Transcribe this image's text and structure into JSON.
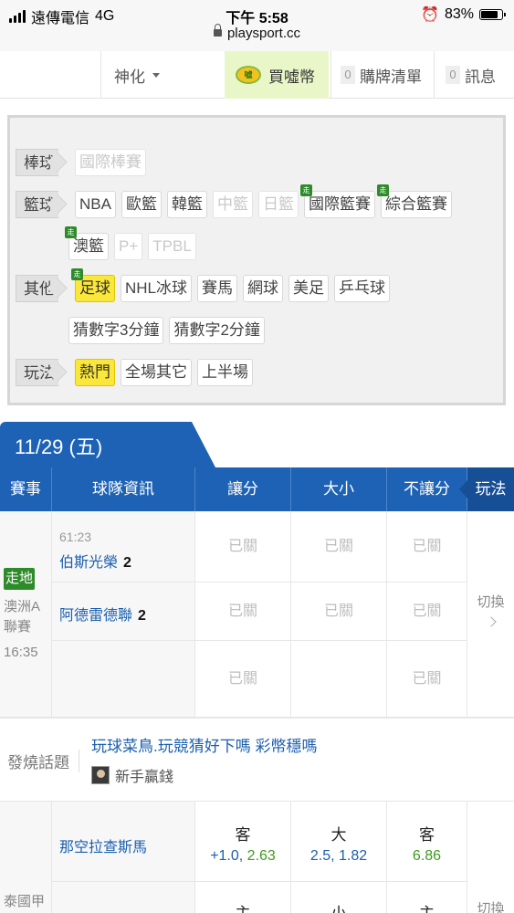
{
  "status_bar": {
    "carrier": "遠傳電信",
    "network": "4G",
    "time": "下午 5:58",
    "url": "playsport.cc",
    "battery": "83%",
    "battery_level": 0.83
  },
  "topnav": {
    "user": "神化",
    "coin_label": "買噓幣",
    "coin_icon_text": "噓",
    "cart_count": "0",
    "cart_label": "購牌清單",
    "msg_count": "0",
    "msg_label": "訊息"
  },
  "categories": {
    "baseball": {
      "label": "棒球",
      "items": [
        "國際棒賽"
      ]
    },
    "basketball": {
      "label": "籃球",
      "items": [
        "NBA",
        "歐籃",
        "韓籃",
        "中籃",
        "日籃",
        "國際籃賽",
        "綜合籃賽"
      ],
      "items2": [
        "澳籃",
        "P+",
        "TPBL"
      ]
    },
    "others": {
      "label": "其他",
      "items": [
        "足球",
        "NHL冰球",
        "賽馬",
        "網球",
        "美足",
        "乒乓球"
      ],
      "items2": [
        "猜數字3分鐘",
        "猜數字2分鐘"
      ]
    },
    "play": {
      "label": "玩法",
      "items": [
        "熱門",
        "全場其它",
        "上半場"
      ]
    },
    "live_badge": "走"
  },
  "date_tab": "11/29 (五)",
  "table_header": [
    "賽事",
    "球隊資訊",
    "讓分",
    "大小",
    "不讓分",
    "玩法"
  ],
  "match1": {
    "live_badge": "走地",
    "league": "澳洲A聯賽",
    "time": "16:35",
    "clock": "61:23",
    "team_away": "伯斯光榮",
    "score_away": "2",
    "team_home": "阿德雷德聯",
    "score_home": "2",
    "closed": "已關",
    "switch": "切換"
  },
  "hot_topic": {
    "label": "發燒話題",
    "title": "玩球菜鳥.玩競猜好下嗎 彩幣穩嗎",
    "author": "新手贏錢"
  },
  "match2": {
    "league": "泰國甲",
    "team_away": "那空拉查斯馬",
    "spread_label": "客",
    "spread_line": "+1.0",
    "spread_odds": "2.63",
    "total_label": "大",
    "total_line": "2.5",
    "total_odds": "1.82",
    "ml_label": "客",
    "ml_odds": "6.86",
    "spread_label_home": "主",
    "total_label_home": "小",
    "ml_label_home": "主",
    "switch": "切換"
  }
}
